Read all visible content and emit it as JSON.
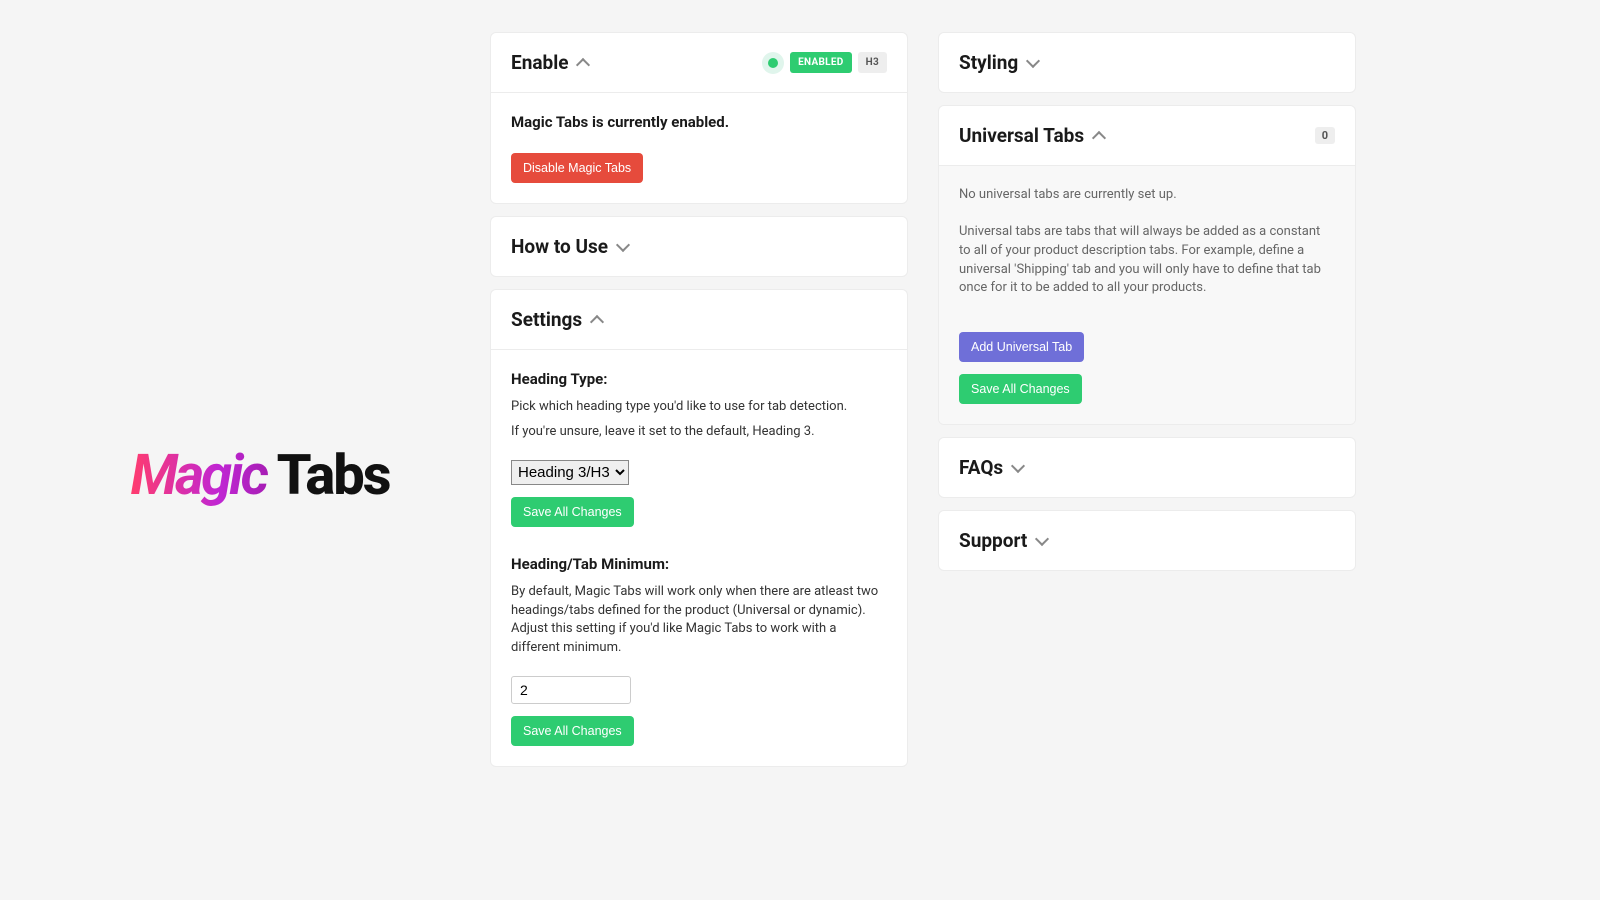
{
  "logo": {
    "word1": "Magic ",
    "word2": "Tabs"
  },
  "enable": {
    "title": "Enable",
    "status_pill": "ENABLED",
    "heading_pill": "H3",
    "status_text": "Magic Tabs is currently enabled.",
    "disable_button": "Disable Magic Tabs"
  },
  "howto": {
    "title": "How to Use"
  },
  "settings": {
    "title": "Settings",
    "heading_type": {
      "label": "Heading Type:",
      "desc1": "Pick which heading type you'd like to use for tab detection.",
      "desc2": "If you're unsure, leave it set to the default, Heading 3.",
      "selected": "Heading 3/H3",
      "save": "Save All Changes"
    },
    "minimum": {
      "label": "Heading/Tab Minimum:",
      "desc": "By default, Magic Tabs will work only when there are atleast two headings/tabs defined for the product (Universal or dynamic). Adjust this setting if you'd like Magic Tabs to work with a different minimum.",
      "value": "2",
      "save": "Save All Changes"
    }
  },
  "styling": {
    "title": "Styling"
  },
  "universal": {
    "title": "Universal Tabs",
    "count": "0",
    "empty_text": "No universal tabs are currently set up.",
    "desc": "Universal tabs are tabs that will always be added as a constant to all of your product description tabs. For example, define a universal 'Shipping' tab and you will only have to define that tab once for it to be added to all your products.",
    "add_button": "Add Universal Tab",
    "save_button": "Save All Changes"
  },
  "faqs": {
    "title": "FAQs"
  },
  "support": {
    "title": "Support"
  }
}
